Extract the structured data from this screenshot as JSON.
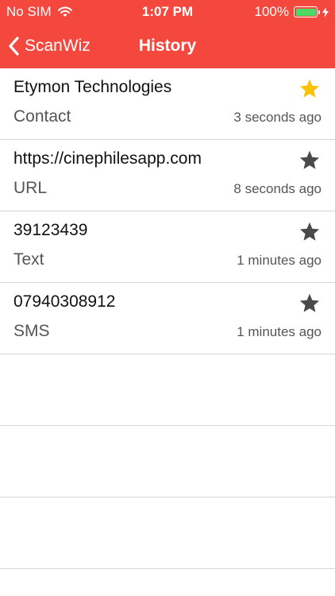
{
  "status_bar": {
    "carrier": "No SIM",
    "time": "1:07 PM",
    "battery_percent": "100%",
    "battery_color": "#4cd964"
  },
  "nav": {
    "back_label": "ScanWiz",
    "title": "History",
    "bar_color": "#f4473d"
  },
  "history": [
    {
      "title": "Etymon Technologies",
      "type": "Contact",
      "time": "3 seconds ago",
      "starred": true,
      "star_icon": "star-filled-icon"
    },
    {
      "title": "https://cinephilesapp.com",
      "type": "URL",
      "time": "8 seconds ago",
      "starred": false,
      "star_icon": "star-icon"
    },
    {
      "title": "39123439",
      "type": "Text",
      "time": "1 minutes ago",
      "starred": false,
      "star_icon": "star-icon"
    },
    {
      "title": "07940308912",
      "type": "SMS",
      "time": "1 minutes ago",
      "starred": false,
      "star_icon": "star-icon"
    }
  ],
  "colors": {
    "star_active": "#f9c20a",
    "star_inactive": "#4a4a4a"
  }
}
